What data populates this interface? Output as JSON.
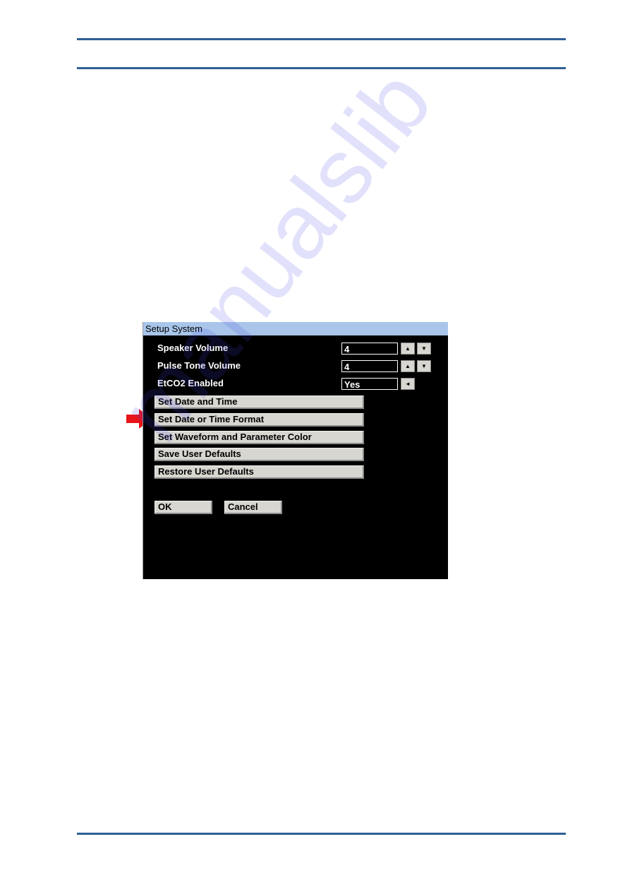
{
  "dialog": {
    "title": "Setup System",
    "rows": [
      {
        "label": "Speaker Volume",
        "value": "4",
        "controls": [
          "up-arrow",
          "down-arrow"
        ]
      },
      {
        "label": "Pulse Tone Volume",
        "value": "4",
        "controls": [
          "up-arrow",
          "down-arrow"
        ]
      },
      {
        "label": "EtCO2 Enabled",
        "value": "Yes",
        "controls": [
          "left-arrow"
        ]
      }
    ],
    "spin_glyphs": {
      "up": "▲",
      "down": "▼",
      "left": "◄"
    },
    "menu_buttons": [
      "Set Date and Time",
      "Set Date or Time Format",
      "Set Waveform and Parameter Color",
      "Save User Defaults",
      "Restore User Defaults"
    ],
    "ok_label": "OK",
    "cancel_label": "Cancel"
  },
  "annotation": {
    "pointer": "red-arrow",
    "points_to": "Set Date or Time Format",
    "color": "#e8141a"
  },
  "watermark": "manualslib",
  "colors": {
    "rule": "#2f5f96",
    "titlebar": "#a9c6ea",
    "button": "#d8d6d0",
    "screen_bg": "#000000"
  }
}
